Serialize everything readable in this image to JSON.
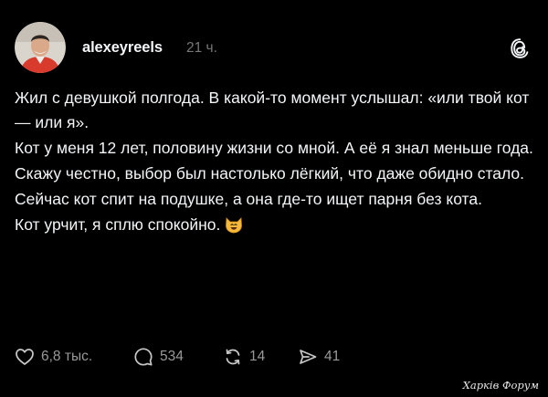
{
  "post": {
    "author": {
      "username": "alexeyreels",
      "avatar_icon": "avatar-photo"
    },
    "timestamp": "21 ч.",
    "app_icon": "threads-icon",
    "paragraphs": [
      "Жил с девушкой полгода. В какой-то момент услышал: «или твой кот — или я».",
      "Кот у меня 12 лет, половину жизни со мной. А её я знал меньше года.",
      "Скажу честно, выбор был настолько лёгкий, что даже обидно стало.",
      "Сейчас кот спит на подушке, а она где-то ищет парня без кота.",
      "Кот урчит, я сплю спокойно."
    ],
    "trailing_emoji": "smiling-cat-emoji",
    "actions": {
      "likes": "6,8 тыс.",
      "comments": "534",
      "reposts": "14",
      "shares": "41"
    }
  },
  "watermark": "Харків Форум",
  "colors": {
    "background": "#000000",
    "text": "#f3f5f7",
    "secondary": "#777777",
    "action": "#999999"
  }
}
